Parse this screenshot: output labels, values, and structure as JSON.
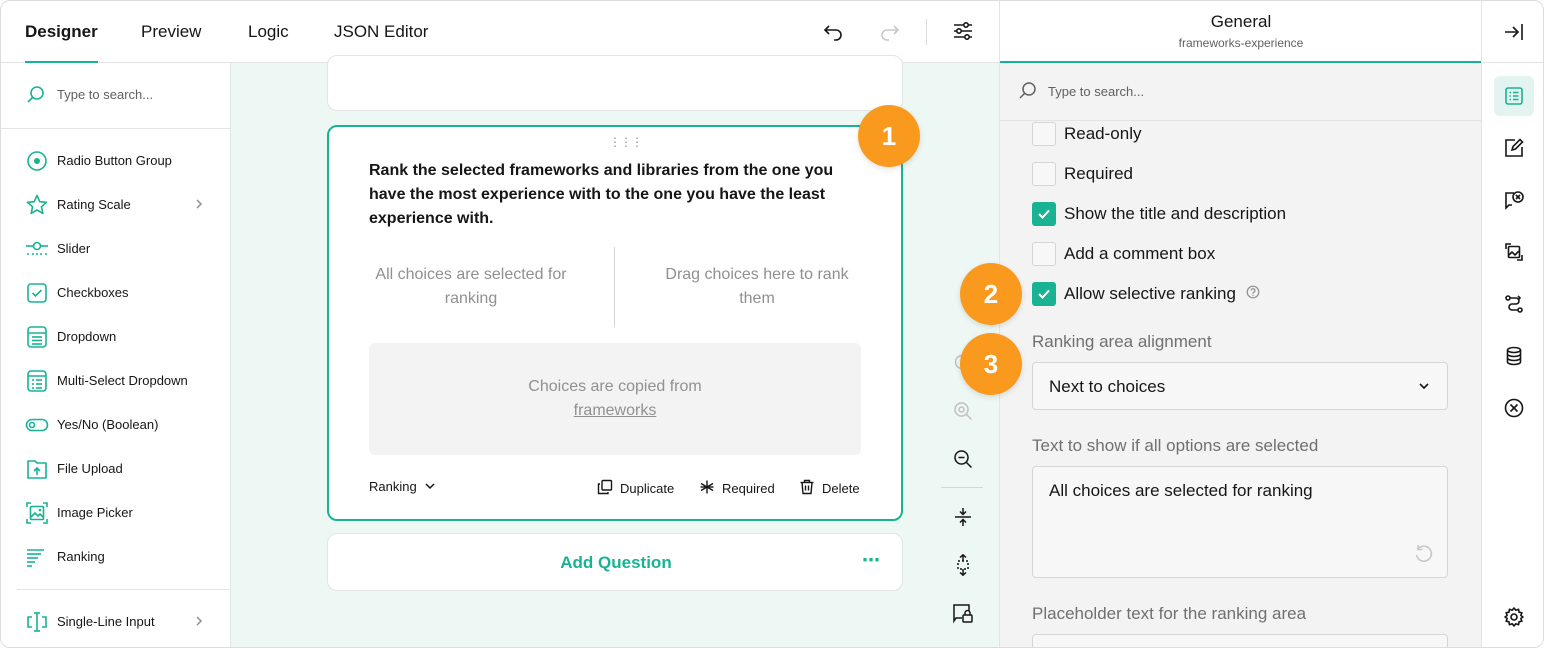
{
  "tabs": [
    {
      "label": "Designer",
      "active": true
    },
    {
      "label": "Preview"
    },
    {
      "label": "Logic"
    },
    {
      "label": "JSON Editor"
    }
  ],
  "toolbox": {
    "search_placeholder": "Type to search...",
    "items": [
      {
        "label": "Radio Button Group",
        "icon": "radio-icon"
      },
      {
        "label": "Rating Scale",
        "icon": "star-icon",
        "has_submenu": true
      },
      {
        "label": "Slider",
        "icon": "slider-icon"
      },
      {
        "label": "Checkboxes",
        "icon": "checkbox-icon"
      },
      {
        "label": "Dropdown",
        "icon": "dropdown-icon"
      },
      {
        "label": "Multi-Select Dropdown",
        "icon": "multiselect-icon"
      },
      {
        "label": "Yes/No (Boolean)",
        "icon": "toggle-icon"
      },
      {
        "label": "File Upload",
        "icon": "file-upload-icon"
      },
      {
        "label": "Image Picker",
        "icon": "image-picker-icon"
      },
      {
        "label": "Ranking",
        "icon": "ranking-icon"
      },
      {
        "label": "Single-Line Input",
        "icon": "text-input-icon",
        "has_submenu": true
      }
    ]
  },
  "question": {
    "title": "Rank the selected frameworks and libraries from the one you have the most experience with to the one you have the least experience with.",
    "left_area": "All choices are selected for ranking",
    "right_area": "Drag choices here to rank them",
    "copied_text": "Choices are copied from",
    "copied_link": "frameworks",
    "type_label": "Ranking",
    "duplicate_label": "Duplicate",
    "required_label": "Required",
    "delete_label": "Delete"
  },
  "add_question": {
    "label": "Add Question",
    "more": "⋯"
  },
  "property_grid": {
    "title": "General",
    "subtitle": "frameworks-experience",
    "search_placeholder": "Type to search...",
    "checkboxes": [
      {
        "label": "Read-only",
        "checked": false
      },
      {
        "label": "Required",
        "checked": false
      },
      {
        "label": "Show the title and description",
        "checked": true
      },
      {
        "label": "Add a comment box",
        "checked": false
      },
      {
        "label": "Allow selective ranking",
        "checked": true
      }
    ],
    "alignment_label": "Ranking area alignment",
    "alignment_value": "Next to choices",
    "all_selected_label": "Text to show if all options are selected",
    "all_selected_value": "All choices are selected for ranking",
    "placeholder_label": "Placeholder text for the ranking area"
  },
  "badges": [
    "1",
    "2",
    "3"
  ],
  "colors": {
    "accent": "#19b394",
    "badge": "#f99a1f"
  }
}
